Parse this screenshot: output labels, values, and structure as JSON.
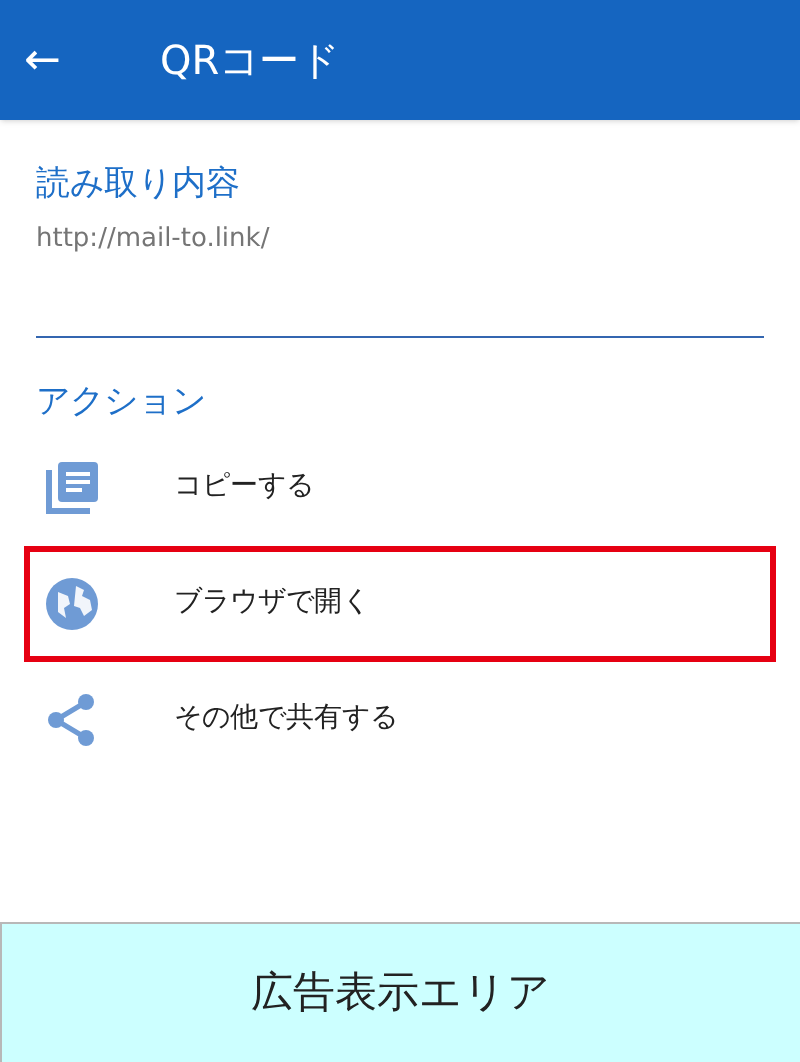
{
  "app_bar": {
    "back": "←",
    "title": "QRコード"
  },
  "content": {
    "label": "読み取り内容",
    "value": "http://mail-to.link/"
  },
  "actions": {
    "label": "アクション",
    "items": [
      {
        "kind": "copy",
        "label": "コピーする",
        "highlighted": false
      },
      {
        "kind": "browser",
        "label": "ブラウザで開く",
        "highlighted": true
      },
      {
        "kind": "share",
        "label": "その他で共有する",
        "highlighted": false
      }
    ]
  },
  "ad": {
    "text": "広告表示エリア"
  }
}
